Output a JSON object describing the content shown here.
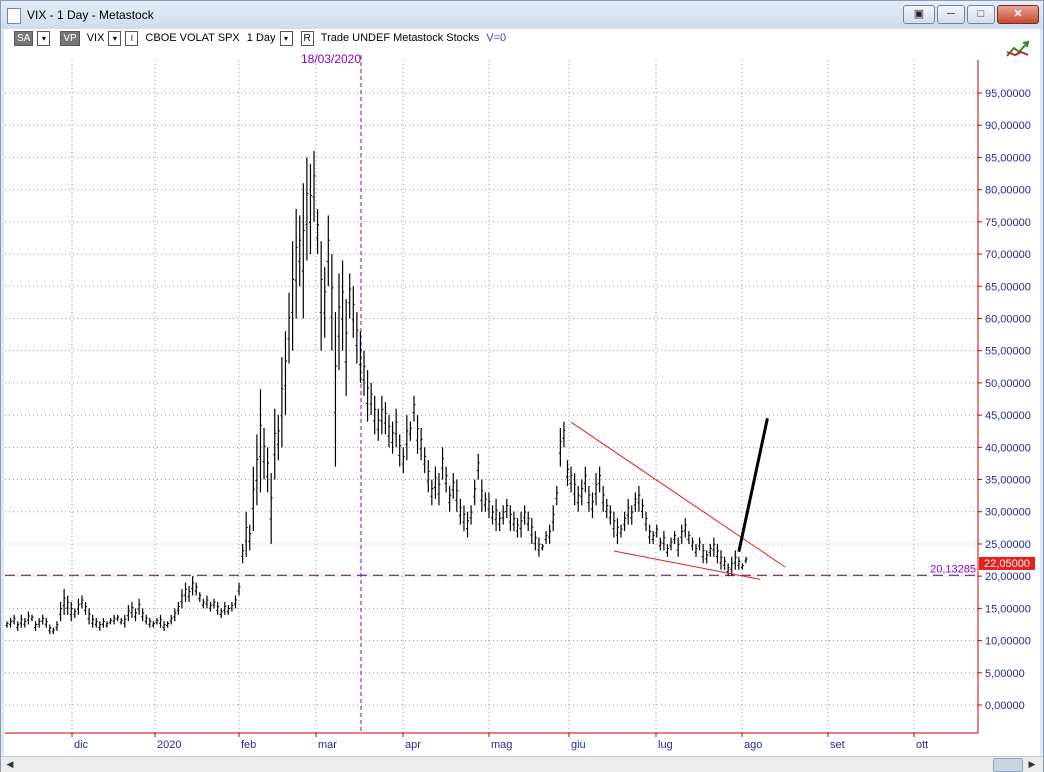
{
  "window": {
    "title": "VIX - 1 Day - Metastock",
    "buttons": [
      "▣",
      "─",
      "□",
      "✕"
    ]
  },
  "toolbar": {
    "sa": "SA",
    "vp": "VP",
    "symbol": "VIX",
    "name": "CBOE VOLAT SPX",
    "period": "1 Day",
    "r_label": "R",
    "info": "Trade  UNDEF  Metastock  Stocks",
    "volume": "V=0"
  },
  "icons": {
    "indicator": "trend-arrows-icon",
    "app": "document-icon"
  },
  "colors": {
    "axis_red": "#cc0000",
    "tick_label_blue": "#1f2c99",
    "marker_purple": "#8800cc",
    "dashed_level": "#660066",
    "trendline": "#dd2222",
    "price_label_bg": "#e8201c"
  },
  "chart_data": {
    "type": "ohlc",
    "y_unit": "index points",
    "ylim": [
      -2,
      100
    ],
    "y_ticks": [
      0,
      5,
      10,
      15,
      20,
      25,
      30,
      35,
      40,
      45,
      50,
      55,
      60,
      65,
      70,
      75,
      80,
      85,
      90,
      95
    ],
    "y_tick_labels": [
      "0,00000",
      "5,00000",
      "10,00000",
      "15,00000",
      "20,00000",
      "25,00000",
      "30,00000",
      "35,00000",
      "40,00000",
      "45,00000",
      "50,00000",
      "55,00000",
      "60,00000",
      "65,00000",
      "70,00000",
      "75,00000",
      "80,00000",
      "85,00000",
      "90,00000",
      "95,00000"
    ],
    "x_month_labels": [
      "dic",
      "2020",
      "feb",
      "mar",
      "apr",
      "mag",
      "giu",
      "lug",
      "ago",
      "set",
      "ott"
    ],
    "grid": true,
    "marker_date_label": "18/03/2020",
    "horizontal_level": {
      "value": 20.13285,
      "label": "20,13285"
    },
    "last_price": {
      "value": 22.05,
      "label": "22,05000"
    },
    "bars": [
      [
        13,
        12
      ],
      [
        13.5,
        12
      ],
      [
        14,
        12.5
      ],
      [
        13,
        11.5
      ],
      [
        14,
        12
      ],
      [
        13.5,
        12
      ],
      [
        14.5,
        12.5
      ],
      [
        14,
        13
      ],
      [
        13,
        11.5
      ],
      [
        13.5,
        12
      ],
      [
        14,
        12.5
      ],
      [
        13.5,
        12
      ],
      [
        12.5,
        11
      ],
      [
        12,
        11
      ],
      [
        13,
        11.5
      ],
      [
        16,
        13
      ],
      [
        18,
        14
      ],
      [
        17,
        14
      ],
      [
        16,
        13
      ],
      [
        15,
        13.5
      ],
      [
        16.5,
        14
      ],
      [
        17,
        15
      ],
      [
        16,
        14
      ],
      [
        15,
        12.5
      ],
      [
        14,
        12
      ],
      [
        13.5,
        12
      ],
      [
        13,
        11.5
      ],
      [
        13.5,
        12
      ],
      [
        13,
        12
      ],
      [
        13.5,
        12.5
      ],
      [
        14,
        12.5
      ],
      [
        14,
        13
      ],
      [
        13.5,
        12.5
      ],
      [
        14,
        12
      ],
      [
        15.5,
        13
      ],
      [
        16,
        13.5
      ],
      [
        15,
        13
      ],
      [
        16.5,
        14
      ],
      [
        15,
        13
      ],
      [
        14,
        12.5
      ],
      [
        13.5,
        12
      ],
      [
        13,
        12
      ],
      [
        13.5,
        12.5
      ],
      [
        14,
        12
      ],
      [
        13,
        11.5
      ],
      [
        13,
        12
      ],
      [
        14,
        12.5
      ],
      [
        15,
        13
      ],
      [
        16,
        14
      ],
      [
        18,
        15
      ],
      [
        19,
        16
      ],
      [
        18.5,
        16
      ],
      [
        20,
        17
      ],
      [
        19,
        17
      ],
      [
        17.5,
        16
      ],
      [
        16.5,
        15
      ],
      [
        17,
        15
      ],
      [
        16,
        14.5
      ],
      [
        16.5,
        15
      ],
      [
        16,
        14
      ],
      [
        15,
        13.5
      ],
      [
        16,
        14
      ],
      [
        15.5,
        14
      ],
      [
        16,
        14.5
      ],
      [
        17,
        15
      ],
      [
        19,
        17
      ],
      [
        25,
        22
      ],
      [
        30,
        23
      ],
      [
        28,
        24
      ],
      [
        37,
        27
      ],
      [
        42,
        31
      ],
      [
        49,
        33
      ],
      [
        43,
        35
      ],
      [
        40,
        33
      ],
      [
        36,
        25
      ],
      [
        46,
        35
      ],
      [
        45,
        38
      ],
      [
        54,
        40
      ],
      [
        58,
        45
      ],
      [
        64,
        53
      ],
      [
        72,
        55
      ],
      [
        77,
        60
      ],
      [
        76,
        65
      ],
      [
        81,
        60
      ],
      [
        85,
        69
      ],
      [
        84,
        70
      ],
      [
        86,
        75
      ],
      [
        77,
        70
      ],
      [
        72,
        55
      ],
      [
        68,
        57
      ],
      [
        76,
        65
      ],
      [
        70,
        55
      ],
      [
        61,
        37
      ],
      [
        67,
        52
      ],
      [
        69,
        55
      ],
      [
        63,
        48
      ],
      [
        67,
        60
      ],
      [
        65,
        57
      ],
      [
        61,
        53
      ],
      [
        58,
        50
      ],
      [
        55,
        48
      ],
      [
        52,
        44
      ],
      [
        50,
        45
      ],
      [
        48,
        42
      ],
      [
        46,
        41
      ],
      [
        48,
        42
      ],
      [
        47,
        42
      ],
      [
        45,
        40
      ],
      [
        44,
        39
      ],
      [
        46,
        40
      ],
      [
        42,
        37
      ],
      [
        40,
        36
      ],
      [
        45,
        38
      ],
      [
        44,
        41
      ],
      [
        48,
        44
      ],
      [
        45,
        39
      ],
      [
        43,
        38
      ],
      [
        40,
        36
      ],
      [
        38,
        33
      ],
      [
        35,
        31
      ],
      [
        37,
        32
      ],
      [
        36,
        31
      ],
      [
        40,
        35
      ],
      [
        37,
        33
      ],
      [
        34,
        30
      ],
      [
        36,
        32
      ],
      [
        35,
        30
      ],
      [
        32,
        28
      ],
      [
        31,
        27
      ],
      [
        30,
        26
      ],
      [
        31,
        28
      ],
      [
        35,
        31
      ],
      [
        39,
        35
      ],
      [
        35,
        30
      ],
      [
        33,
        30
      ],
      [
        33,
        29
      ],
      [
        31,
        28
      ],
      [
        32,
        27
      ],
      [
        30,
        27
      ],
      [
        31,
        28
      ],
      [
        32,
        29
      ],
      [
        31,
        27
      ],
      [
        30,
        27
      ],
      [
        29,
        26
      ],
      [
        30,
        26
      ],
      [
        31,
        28
      ],
      [
        30,
        27
      ],
      [
        29,
        25
      ],
      [
        27,
        24
      ],
      [
        26,
        23
      ],
      [
        25,
        24
      ],
      [
        27,
        25
      ],
      [
        28,
        25
      ],
      [
        31,
        27
      ],
      [
        34,
        31
      ],
      [
        43,
        37
      ],
      [
        44,
        40
      ],
      [
        38,
        34
      ],
      [
        37,
        33
      ],
      [
        36,
        31
      ],
      [
        34,
        30
      ],
      [
        35,
        31
      ],
      [
        37,
        33
      ],
      [
        34,
        30
      ],
      [
        33,
        29
      ],
      [
        36,
        31
      ],
      [
        37,
        33
      ],
      [
        34,
        30
      ],
      [
        32,
        29
      ],
      [
        31,
        28
      ],
      [
        30,
        26
      ],
      [
        29,
        25
      ],
      [
        28,
        26
      ],
      [
        30,
        27
      ],
      [
        32,
        28
      ],
      [
        31,
        28
      ],
      [
        33,
        30
      ],
      [
        34,
        30
      ],
      [
        32,
        29
      ],
      [
        30,
        27
      ],
      [
        28,
        25
      ],
      [
        27,
        25
      ],
      [
        28,
        26
      ],
      [
        26,
        24
      ],
      [
        27,
        24
      ],
      [
        25,
        23
      ],
      [
        26,
        24
      ],
      [
        27,
        25
      ],
      [
        26,
        23
      ],
      [
        28,
        25
      ],
      [
        29,
        26
      ],
      [
        27,
        25
      ],
      [
        26,
        24
      ],
      [
        25,
        23
      ],
      [
        26,
        24
      ],
      [
        25,
        22
      ],
      [
        24,
        22
      ],
      [
        25,
        23
      ],
      [
        26,
        23
      ],
      [
        25,
        22
      ],
      [
        24,
        21
      ],
      [
        23,
        21
      ],
      [
        22,
        20
      ],
      [
        23,
        20
      ],
      [
        24,
        21
      ],
      [
        23,
        21
      ],
      [
        22,
        21
      ],
      [
        23,
        22
      ]
    ],
    "trendlines": [
      {
        "from": {
          "bar": 158,
          "value": 43.9
        },
        "to": {
          "bar": 218,
          "value": 21.4
        }
      },
      {
        "from": {
          "bar": 170,
          "value": 23.9
        },
        "to": {
          "bar": 211,
          "value": 19.5
        }
      }
    ],
    "projection": {
      "from": {
        "bar": 205,
        "value": 23.8
      },
      "to": {
        "bar": 213,
        "value": 44.5
      }
    }
  }
}
